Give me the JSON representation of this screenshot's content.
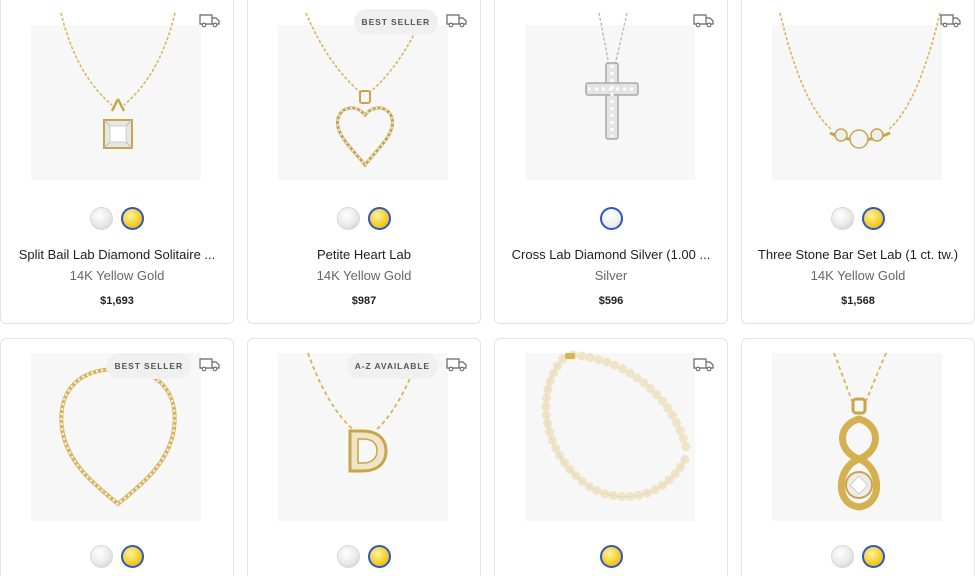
{
  "products": [
    {
      "badge": "",
      "title": "Split Bail Lab Diamond Solitaire ...",
      "metal": "14K Yellow Gold",
      "price": "$1,693",
      "swatches": [
        "white",
        "gold"
      ],
      "image": "solitaire-pendant"
    },
    {
      "badge": "BEST SELLER",
      "title": "Petite Heart Lab",
      "metal": "14K Yellow Gold",
      "price": "$987",
      "swatches": [
        "white",
        "gold"
      ],
      "image": "heart-pendant"
    },
    {
      "badge": "",
      "title": "Cross Lab Diamond Silver (1.00 ...",
      "metal": "Silver",
      "price": "$596",
      "swatches": [
        "silver"
      ],
      "image": "cross-pendant"
    },
    {
      "badge": "",
      "title": "Three Stone Bar Set Lab (1 ct. tw.)",
      "metal": "14K Yellow Gold",
      "price": "$1,568",
      "swatches": [
        "white",
        "gold"
      ],
      "image": "three-stone-necklace"
    },
    {
      "badge": "BEST SELLER",
      "title": "",
      "metal": "",
      "price": "",
      "swatches": [
        "white",
        "gold"
      ],
      "image": "tennis-necklace"
    },
    {
      "badge": "A-Z AVAILABLE",
      "title": "",
      "metal": "",
      "price": "",
      "swatches": [
        "white",
        "gold"
      ],
      "image": "initial-d-pendant"
    },
    {
      "badge": "",
      "title": "",
      "metal": "",
      "price": "",
      "swatches": [
        "gold"
      ],
      "image": "pearl-necklace"
    },
    {
      "badge": "",
      "title": "",
      "metal": "",
      "price": "",
      "swatches": [
        "white",
        "gold"
      ],
      "image": "infinity-knot-pendant"
    }
  ],
  "icons": {
    "shipping": "truck-icon",
    "swatch_white": "white-gold-swatch",
    "swatch_yellow": "yellow-gold-swatch",
    "swatch_silver": "silver-swatch"
  },
  "colors": {
    "gold": "#d9b55a",
    "selected_ring": "#2f56c9",
    "card_border": "#e4e4e4",
    "badge_bg": "#f0f0f0"
  }
}
